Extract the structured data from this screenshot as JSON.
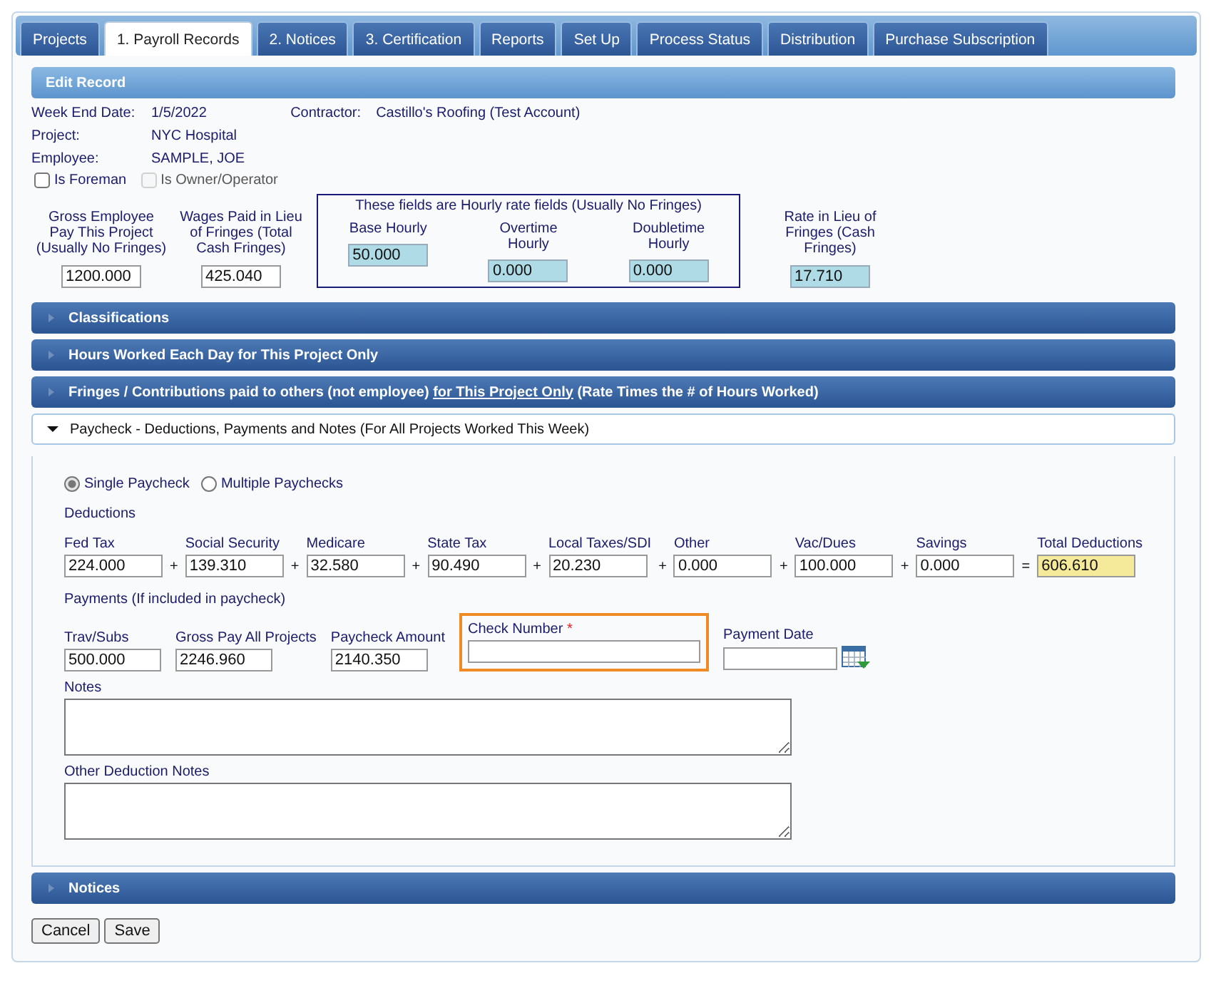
{
  "tabs": [
    {
      "label": "Projects",
      "selected": false
    },
    {
      "label": "1. Payroll Records",
      "selected": true
    },
    {
      "label": "2. Notices",
      "selected": false
    },
    {
      "label": "3. Certification",
      "selected": false
    },
    {
      "label": "Reports",
      "selected": false
    },
    {
      "label": "Set Up",
      "selected": false
    },
    {
      "label": "Process Status",
      "selected": false
    },
    {
      "label": "Distribution",
      "selected": false
    },
    {
      "label": "Purchase Subscription",
      "selected": false
    }
  ],
  "edit_record": {
    "title": "Edit Record",
    "info": [
      {
        "label": "Week End Date:",
        "value": "1/5/2022"
      },
      {
        "label": "Project:",
        "value": "NYC Hospital"
      },
      {
        "label": "Employee:",
        "value": "SAMPLE, JOE"
      }
    ],
    "contractor": {
      "label": "Contractor:",
      "value": "Castillo's Roofing (Test Account)"
    },
    "checkboxes": [
      {
        "label": "Is Foreman",
        "checked": false,
        "disabled": false
      },
      {
        "label": "Is Owner/Operator",
        "checked": false,
        "disabled": true
      }
    ],
    "rate_fields": [
      {
        "kind": "plain",
        "label": "Gross Employee Pay This Project (Usually No Fringes)",
        "value": "1200.000"
      },
      {
        "kind": "plain",
        "label": "Wages Paid in Lieu of Fringes (Total Cash Fringes)",
        "value": "425.040"
      },
      {
        "kind": "group",
        "caption": "These fields are Hourly rate fields (Usually No Fringes)",
        "fields": [
          {
            "label": "Base Hourly",
            "value": "50.000"
          },
          {
            "label": "Overtime Hourly",
            "value": "0.000"
          },
          {
            "label": "Doubletime Hourly",
            "value": "0.000"
          }
        ]
      },
      {
        "kind": "computed",
        "label": "Rate in Lieu of Fringes (Cash Fringes)",
        "value": "17.710"
      }
    ]
  },
  "sections": [
    {
      "title": [
        {
          "text": "Classifications",
          "underlined": false
        }
      ],
      "expanded": false
    },
    {
      "title": [
        {
          "text": "Hours Worked Each Day for This Project Only",
          "underlined": false
        }
      ],
      "expanded": false
    },
    {
      "title": [
        {
          "text": "Fringes / Contributions paid to others (not employee) ",
          "underlined": false
        },
        {
          "text": "for This Project Only",
          "underlined": true
        },
        {
          "text": " (Rate Times the # of Hours Worked)",
          "underlined": false
        }
      ],
      "expanded": false
    },
    {
      "title": [
        {
          "text": "Paycheck - Deductions, Payments and Notes (For All Projects Worked This Week)",
          "underlined": false
        }
      ],
      "expanded": true
    },
    {
      "title": [
        {
          "text": "Notices",
          "underlined": false
        }
      ],
      "expanded": false
    }
  ],
  "paycheck": {
    "paycheck_types": [
      {
        "label": "Single Paycheck",
        "selected": true
      },
      {
        "label": "Multiple Paychecks",
        "selected": false
      }
    ],
    "deductions_heading": "Deductions",
    "deductions": [
      {
        "label": "Fed Tax",
        "value": "224.000",
        "op": "+"
      },
      {
        "label": "Social Security",
        "value": "139.310",
        "op": "+"
      },
      {
        "label": "Medicare",
        "value": "32.580",
        "op": "+"
      },
      {
        "label": "State Tax",
        "value": "90.490",
        "op": "+"
      },
      {
        "label": "Local Taxes/SDI",
        "value": "20.230",
        "op": "+"
      },
      {
        "label": "Other",
        "value": "0.000",
        "op": "+"
      },
      {
        "label": "Vac/Dues",
        "value": "100.000",
        "op": "+"
      },
      {
        "label": "Savings",
        "value": "0.000",
        "op": "="
      }
    ],
    "total": {
      "label": "Total Deductions",
      "value": "606.610"
    },
    "payments_heading": "Payments (If included in paycheck)",
    "payments": [
      {
        "kind": "plain",
        "label": "Trav/Subs",
        "value": "500.000"
      },
      {
        "kind": "plain",
        "label": "Gross Pay All Projects",
        "value": "2246.960"
      },
      {
        "kind": "plain",
        "label": "Paycheck Amount",
        "value": "2140.350"
      },
      {
        "kind": "required",
        "label": "Check Number",
        "required_mark": "*",
        "highlighted": true
      },
      {
        "kind": "date",
        "label": "Payment Date"
      }
    ],
    "notes": [
      {
        "label": "Notes"
      },
      {
        "label": "Other Deduction Notes"
      }
    ]
  },
  "buttons": [
    "Cancel",
    "Save"
  ]
}
